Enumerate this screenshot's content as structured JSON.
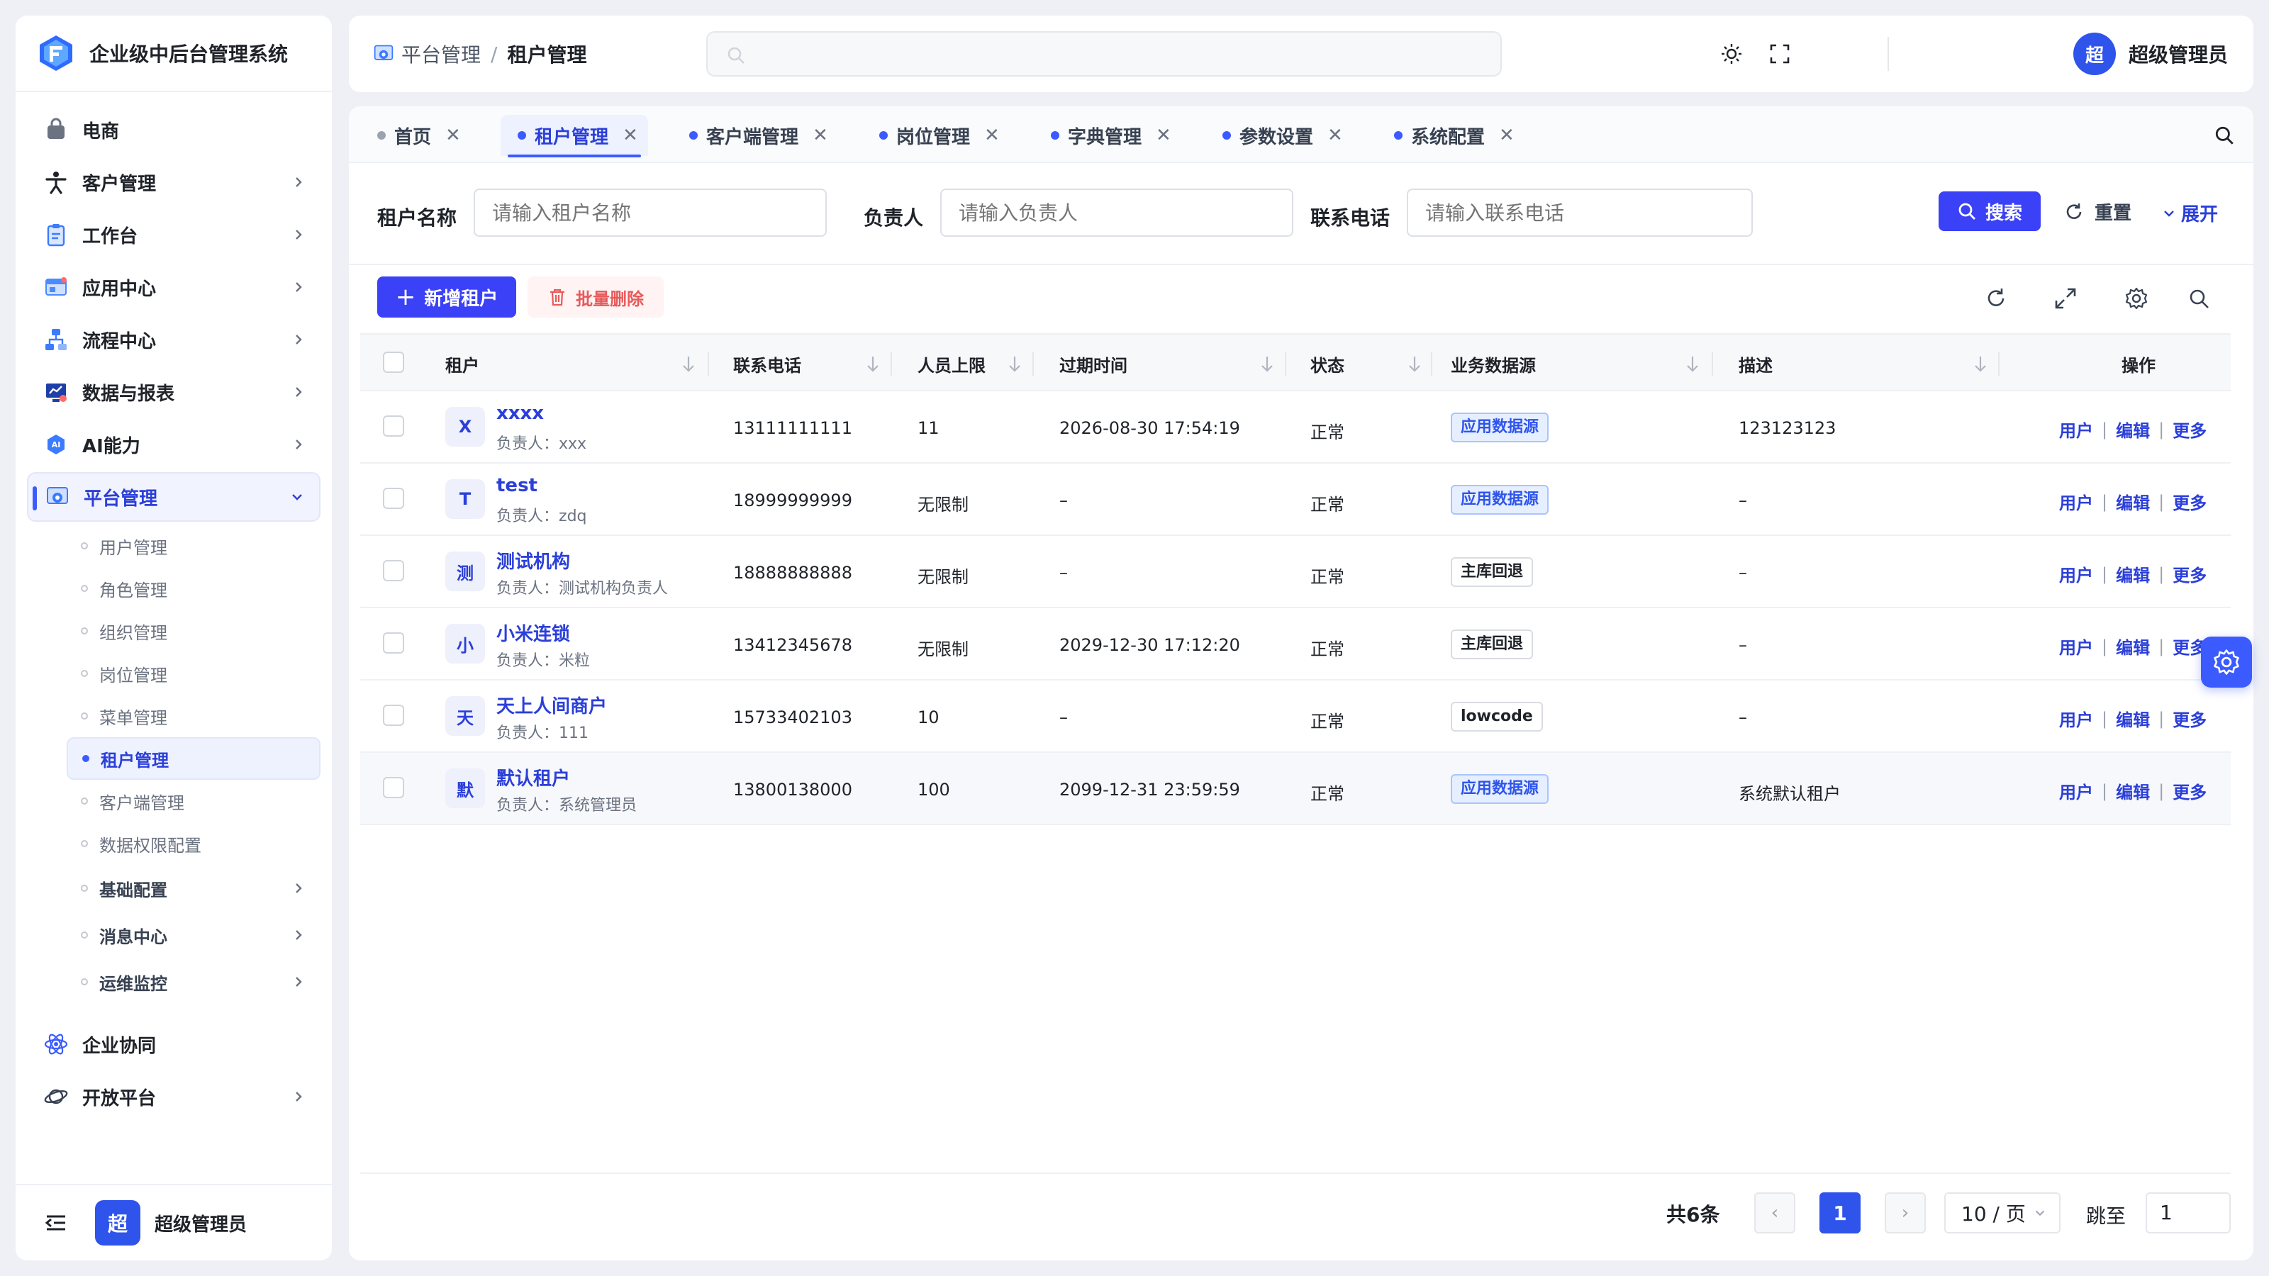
{
  "app": {
    "title": "企业级中后台管理系统"
  },
  "sidebar": {
    "items": [
      {
        "label": "电商",
        "icon": "bag-icon"
      },
      {
        "label": "客户管理",
        "icon": "person-icon"
      },
      {
        "label": "工作台",
        "icon": "clipboard-icon"
      },
      {
        "label": "应用中心",
        "icon": "app-window-icon"
      },
      {
        "label": "流程中心",
        "icon": "flow-icon"
      },
      {
        "label": "数据与报表",
        "icon": "report-icon"
      },
      {
        "label": "AI能力",
        "icon": "ai-icon"
      },
      {
        "label": "平台管理",
        "icon": "platform-icon"
      }
    ],
    "submenu": [
      {
        "label": "用户管理"
      },
      {
        "label": "角色管理"
      },
      {
        "label": "组织管理"
      },
      {
        "label": "岗位管理"
      },
      {
        "label": "菜单管理"
      },
      {
        "label": "租户管理"
      },
      {
        "label": "客户端管理"
      },
      {
        "label": "数据权限配置"
      },
      {
        "label": "基础配置"
      },
      {
        "label": "消息中心"
      },
      {
        "label": "运维监控"
      }
    ],
    "bottom_items": [
      {
        "label": "企业协同",
        "icon": "atom-icon"
      },
      {
        "label": "开放平台",
        "icon": "planet-icon"
      }
    ],
    "footer": {
      "avatar": "超",
      "name": "超级管理员"
    }
  },
  "header": {
    "breadcrumb": [
      "平台管理",
      "租户管理"
    ],
    "user": {
      "avatar": "超",
      "name": "超级管理员"
    }
  },
  "tabs": [
    {
      "label": "首页"
    },
    {
      "label": "租户管理"
    },
    {
      "label": "客户端管理"
    },
    {
      "label": "岗位管理"
    },
    {
      "label": "字典管理"
    },
    {
      "label": "参数设置"
    },
    {
      "label": "系统配置"
    }
  ],
  "filter": {
    "name_label": "租户名称",
    "name_placeholder": "请输入租户名称",
    "owner_label": "负责人",
    "owner_placeholder": "请输入负责人",
    "phone_label": "联系电话",
    "phone_placeholder": "请输入联系电话",
    "search_label": "搜索",
    "reset_label": "重置",
    "expand_label": "展开"
  },
  "toolbar": {
    "add_label": "新增租户",
    "batch_delete_label": "批量删除"
  },
  "table": {
    "columns": [
      "租户",
      "联系电话",
      "人员上限",
      "过期时间",
      "状态",
      "业务数据源",
      "描述",
      "操作"
    ],
    "owner_prefix": "负责人：",
    "rows": [
      {
        "avatar": "X",
        "name": "xxxx",
        "owner": "xxx",
        "phone": "13111111111",
        "limit": "11",
        "expire": "2026-08-30 17:54:19",
        "status": "正常",
        "datasource": "应用数据源",
        "ds_style": "blue",
        "desc": "123123123"
      },
      {
        "avatar": "T",
        "name": "test",
        "owner": "zdq",
        "phone": "18999999999",
        "limit": "无限制",
        "expire": "–",
        "status": "正常",
        "datasource": "应用数据源",
        "ds_style": "blue",
        "desc": "–"
      },
      {
        "avatar": "测",
        "name": "测试机构",
        "owner": "测试机构负责人",
        "phone": "18888888888",
        "limit": "无限制",
        "expire": "–",
        "status": "正常",
        "datasource": "主库回退",
        "ds_style": "grey",
        "desc": "–"
      },
      {
        "avatar": "小",
        "name": "小米连锁",
        "owner": "米粒",
        "phone": "13412345678",
        "limit": "无限制",
        "expire": "2029-12-30 17:12:20",
        "status": "正常",
        "datasource": "主库回退",
        "ds_style": "grey",
        "desc": "–"
      },
      {
        "avatar": "天",
        "name": "天上人间商户",
        "owner": "111",
        "phone": "15733402103",
        "limit": "10",
        "expire": "–",
        "status": "正常",
        "datasource": "lowcode",
        "ds_style": "grey",
        "desc": "–"
      },
      {
        "avatar": "默",
        "name": "默认租户",
        "owner": "系统管理员",
        "phone": "13800138000",
        "limit": "100",
        "expire": "2099-12-31 23:59:59",
        "status": "正常",
        "datasource": "应用数据源",
        "ds_style": "blue",
        "desc": "系统默认租户"
      }
    ],
    "ops": [
      "用户",
      "编辑",
      "更多"
    ]
  },
  "pagination": {
    "total": "共6条",
    "current": "1",
    "page_size": "10 / 页",
    "jump_label": "跳至",
    "jump_value": "1"
  },
  "colors": {
    "primary": "#3b41f6",
    "link": "#2b3fd9",
    "danger": "#e65a5a"
  }
}
